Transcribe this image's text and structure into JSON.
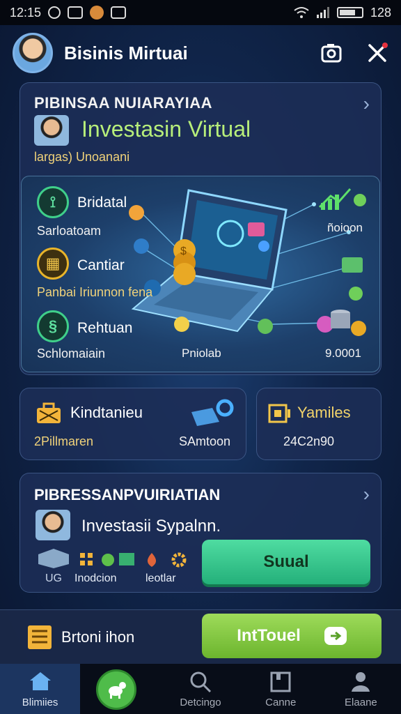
{
  "status_bar": {
    "time": "12:15",
    "battery_text": "128"
  },
  "header": {
    "title": "Bisinis Mirtuai"
  },
  "main_card": {
    "kicker": "PIBINSAA NUIARAYIAA",
    "title": "Investasin Virtual",
    "subtitle": "largas) Unoanani",
    "features": [
      {
        "label": "Bridatal",
        "sub": "Sarloatoam",
        "right": "ñoioon",
        "icon": "growth-icon"
      },
      {
        "label": "Cantiar",
        "sub": "Panbai Iriunnon fena",
        "right": "",
        "icon": "grid-icon"
      },
      {
        "label": "Rehtuan",
        "sub": "Schlomaiain",
        "right": "9.0001",
        "icon": "spiral-icon"
      }
    ],
    "panel_center_label": "Pniolab"
  },
  "card_left": {
    "title": "Kindtanieu",
    "left_value": "2Pillmaren",
    "right_value": "SAmtoon"
  },
  "card_right": {
    "title": "Yamiles",
    "value": "24C2n90"
  },
  "card_bottom": {
    "kicker": "PIBRESSANPVUIRIATIAN",
    "title": "Investasii Sypalnn.",
    "labels": [
      "UG",
      "Inodcion",
      "leotlar"
    ],
    "button": "Suual"
  },
  "promo": {
    "label": "Brtoni ihon",
    "button": "IntTouel"
  },
  "bottom_nav": [
    {
      "label": "Blimiies",
      "icon": "home-icon",
      "active": true
    },
    {
      "label": "",
      "icon": "pet-icon",
      "active": false
    },
    {
      "label": "Detcingo",
      "icon": "search-icon",
      "active": false
    },
    {
      "label": "Canne",
      "icon": "bookmark-icon",
      "active": false
    },
    {
      "label": "Elaane",
      "icon": "profile-icon",
      "active": false
    }
  ],
  "colors": {
    "accent_green": "#4fdca1",
    "title_green": "#b7ee7a",
    "gold": "#f0d27a"
  }
}
